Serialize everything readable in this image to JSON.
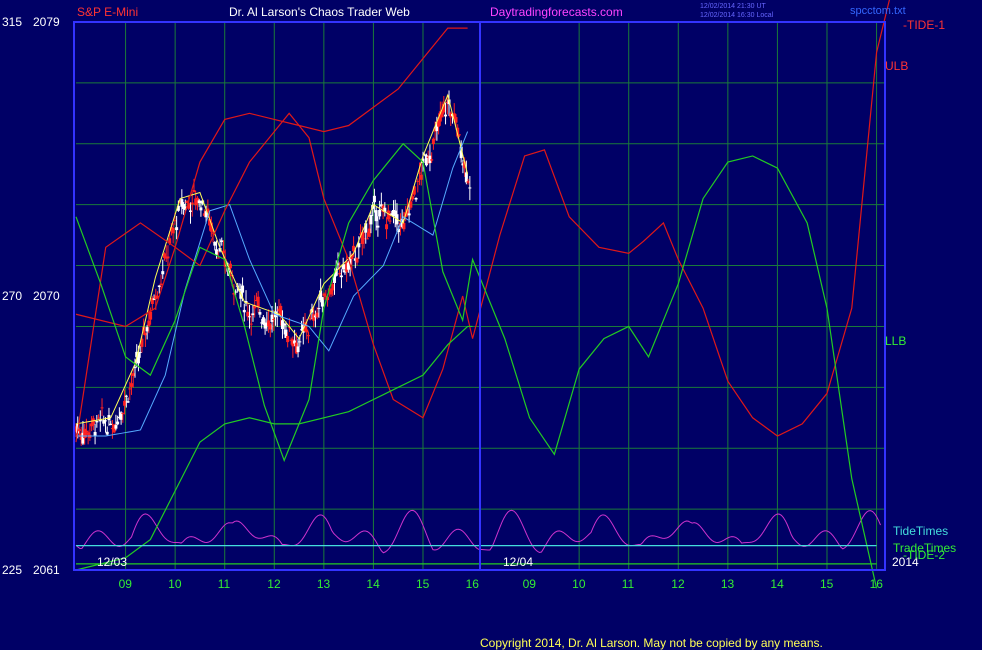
{
  "header": {
    "instrument": "S&P E-Mini",
    "site_title": "Dr. Al Larson's Chaos Trader Web",
    "site_url": "Daytradingforecasts.com",
    "timestamp_line1": "12/02/2014 21:30 UT",
    "timestamp_line2": "12/02/2014 16:30 Local",
    "filename": "spcctom.txt"
  },
  "footer": {
    "copyright": "Copyright 2014, Dr. Al Larson. May not be copied by any means."
  },
  "colors": {
    "background": "#000066",
    "frame": "#3333ff",
    "grid": "#1a7a3a",
    "text_white": "#ffffff",
    "text_red": "#ff3333",
    "text_magenta": "#ff44ff",
    "green_label": "#33ee33",
    "cyan": "#44dddd",
    "red_line": "#e01818",
    "green_line": "#22cc22",
    "magenta_line": "#cc33cc",
    "ma_fast": "#ffff55",
    "ma_slow": "#55aaff",
    "bar_up": "#ffffff",
    "bar_down": "#ff2222"
  },
  "chart_data": {
    "type": "line",
    "y_left_labels": [
      {
        "label": "315",
        "price": "2079",
        "value": 315
      },
      {
        "label": "270",
        "price": "2070",
        "value": 270
      },
      {
        "label": "225",
        "price": "2061",
        "value": 225
      }
    ],
    "ylim": [
      225,
      315
    ],
    "xlim": [
      8.0,
      16.15
    ],
    "x_hour_ticks": [
      {
        "label": "09",
        "x": 9
      },
      {
        "label": "10",
        "x": 10
      },
      {
        "label": "11",
        "x": 11
      },
      {
        "label": "12",
        "x": 12
      },
      {
        "label": "13",
        "x": 13
      },
      {
        "label": "14",
        "x": 14
      },
      {
        "label": "15",
        "x": 15
      },
      {
        "label": "16",
        "x": 16
      },
      {
        "label": "09",
        "x": 9
      },
      {
        "label": "10",
        "x": 10
      },
      {
        "label": "11",
        "x": 11
      },
      {
        "label": "12",
        "x": 12
      },
      {
        "label": "13",
        "x": 13
      },
      {
        "label": "14",
        "x": 14
      },
      {
        "label": "15",
        "x": 15
      },
      {
        "label": "16",
        "x": 16
      }
    ],
    "day_labels": [
      "12/03",
      "12/04"
    ],
    "year_label": "2014",
    "line_labels": {
      "tide1": "-TIDE-1",
      "ulb": "ULB",
      "llb": "LLB",
      "tide2": "-TIDE-2",
      "tide_times": "TideTimes",
      "trade_times": "TradeTimes"
    },
    "series": [
      {
        "name": "-TIDE-1",
        "color": "#e01818",
        "points": [
          [
            8.0,
            246
          ],
          [
            8.6,
            278
          ],
          [
            9.3,
            282
          ],
          [
            10.0,
            278
          ],
          [
            10.5,
            275
          ],
          [
            11.0,
            284
          ],
          [
            11.5,
            292
          ],
          [
            12.0,
            297
          ],
          [
            12.3,
            300
          ],
          [
            12.7,
            296
          ],
          [
            13.0,
            286
          ],
          [
            13.5,
            276
          ],
          [
            14.0,
            262
          ],
          [
            14.4,
            253
          ],
          [
            15.0,
            250
          ],
          [
            15.4,
            258
          ],
          [
            15.8,
            270
          ],
          [
            16.0,
            263
          ],
          [
            16.4,
            280
          ],
          [
            16.9,
            293
          ],
          [
            17.3,
            294
          ],
          [
            17.8,
            283
          ],
          [
            18.4,
            278
          ],
          [
            19.0,
            277
          ],
          [
            19.3,
            279
          ],
          [
            19.7,
            282
          ],
          [
            20.0,
            276
          ],
          [
            20.5,
            268
          ],
          [
            21.0,
            256
          ],
          [
            21.5,
            250
          ],
          [
            22.0,
            247
          ],
          [
            22.5,
            249
          ],
          [
            23.0,
            254
          ],
          [
            23.5,
            268
          ],
          [
            24.0,
            310
          ],
          [
            24.3,
            320
          ]
        ]
      },
      {
        "name": "ULB",
        "color": "#e01818",
        "points": [
          [
            8.0,
            267
          ],
          [
            9.0,
            265
          ],
          [
            9.6,
            268
          ],
          [
            10.0,
            278
          ],
          [
            10.5,
            292
          ],
          [
            11.0,
            299
          ],
          [
            11.5,
            300
          ],
          [
            12.0,
            299
          ],
          [
            12.5,
            298
          ],
          [
            13.0,
            297
          ],
          [
            13.5,
            298
          ],
          [
            14.0,
            301
          ],
          [
            14.5,
            304
          ],
          [
            15.0,
            309
          ],
          [
            15.5,
            314
          ],
          [
            15.9,
            314
          ]
        ]
      },
      {
        "name": "LLB",
        "color": "#22cc22",
        "points": [
          [
            8.0,
            283
          ],
          [
            8.5,
            272
          ],
          [
            9.0,
            260
          ],
          [
            9.5,
            257
          ],
          [
            10.0,
            266
          ],
          [
            10.5,
            278
          ],
          [
            11.0,
            276
          ],
          [
            11.4,
            265
          ],
          [
            11.8,
            252
          ],
          [
            12.2,
            243
          ],
          [
            12.7,
            253
          ],
          [
            13.0,
            268
          ],
          [
            13.5,
            282
          ],
          [
            14.0,
            289
          ],
          [
            14.6,
            295
          ],
          [
            15.0,
            292
          ],
          [
            15.4,
            274
          ],
          [
            15.8,
            266
          ],
          [
            16.0,
            276
          ],
          [
            16.5,
            263
          ],
          [
            17.0,
            250
          ],
          [
            17.5,
            244
          ],
          [
            18.0,
            258
          ],
          [
            18.5,
            263
          ],
          [
            19.0,
            265
          ],
          [
            19.4,
            260
          ],
          [
            20.0,
            272
          ],
          [
            20.5,
            286
          ],
          [
            21.0,
            292
          ],
          [
            21.5,
            293
          ],
          [
            22.0,
            291
          ],
          [
            22.6,
            282
          ],
          [
            23.0,
            268
          ],
          [
            23.5,
            240
          ],
          [
            24.0,
            222
          ]
        ]
      },
      {
        "name": "-TIDE-2",
        "color": "#22cc22",
        "points": [
          [
            8.0,
            225
          ],
          [
            9.0,
            227
          ],
          [
            9.5,
            230
          ],
          [
            10.0,
            238
          ],
          [
            10.5,
            246
          ],
          [
            11.0,
            249
          ],
          [
            11.5,
            250
          ],
          [
            12.0,
            249
          ],
          [
            12.5,
            249
          ],
          [
            13.0,
            250
          ],
          [
            13.5,
            251
          ],
          [
            14.0,
            253
          ],
          [
            14.5,
            255
          ],
          [
            15.0,
            257
          ],
          [
            15.5,
            262
          ],
          [
            15.9,
            265
          ],
          [
            16.0,
            265
          ]
        ]
      },
      {
        "name": "TideTimes",
        "color": "#44dddd",
        "points": [
          [
            8.0,
            229
          ],
          [
            24.0,
            229
          ]
        ]
      },
      {
        "name": "TradeTimes",
        "color": "#22cc22",
        "points": [
          [
            8.0,
            226
          ],
          [
            24.0,
            226
          ]
        ]
      }
    ],
    "grid": true
  }
}
